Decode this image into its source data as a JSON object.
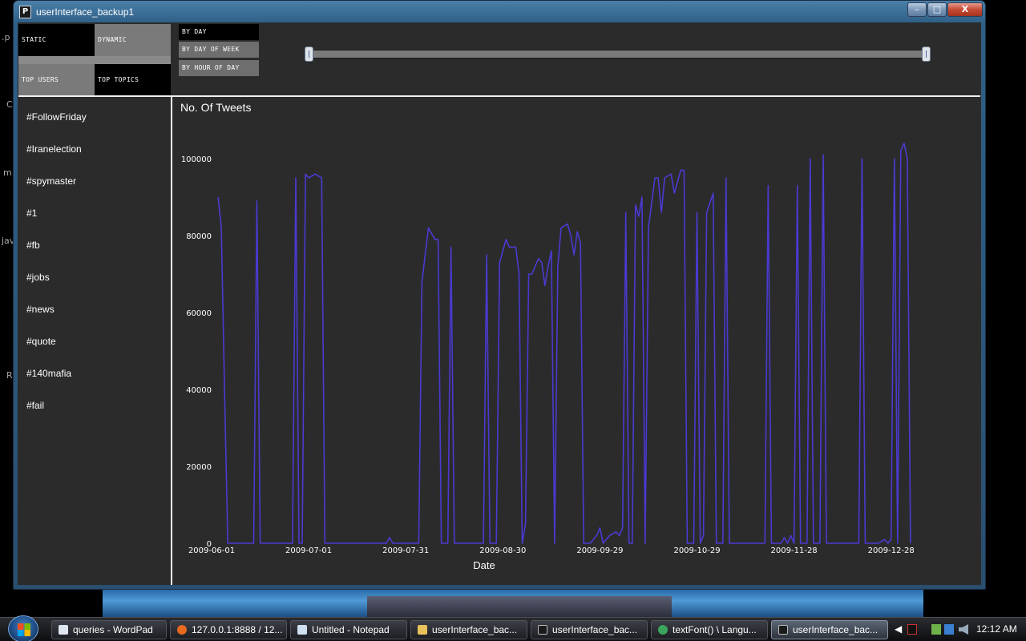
{
  "window": {
    "title": "userInterface_backup1",
    "icon_letter": "P",
    "controls": {
      "minimize": "–",
      "maximize": "□",
      "close": "X"
    }
  },
  "desktop_fragments": [
    ".p",
    "C",
    "m",
    "jav",
    "R"
  ],
  "mode_toggles": {
    "static": "STATIC",
    "dynamic": "DYNAMIC",
    "top_users": "TOP USERS",
    "top_topics": "TOP TOPICS",
    "selected_mode": "static",
    "selected_list": "top_topics"
  },
  "time_buttons": {
    "by_day": "BY DAY",
    "by_day_of_week": "BY DAY OF WEEK",
    "by_hour_of_day": "BY HOUR OF DAY",
    "selected": "by_day"
  },
  "topics": [
    "#FollowFriday",
    "#Iranelection",
    "#spymaster",
    "#1",
    "#fb",
    "#jobs",
    "#news",
    "#quote",
    "#140mafia",
    "#fail"
  ],
  "chart_data": {
    "type": "line",
    "title": "No. Of Tweets",
    "xlabel": "Date",
    "ylabel": "",
    "x_start": "2009-06-01",
    "x_end": "2009-12-31",
    "x_ticks": [
      "2009-06-01",
      "2009-07-01",
      "2009-07-31",
      "2009-08-30",
      "2009-09-29",
      "2009-10-29",
      "2009-11-28",
      "2009-12-28"
    ],
    "ylim": [
      0,
      100000
    ],
    "y_ticks": [
      0,
      20000,
      40000,
      60000,
      80000,
      100000
    ],
    "line_color": "#4a3ad0",
    "series": [
      {
        "points": [
          [
            "2009-06-03",
            90000
          ],
          [
            "2009-06-04",
            82000
          ],
          [
            "2009-06-05",
            40000
          ],
          [
            "2009-06-06",
            0
          ],
          [
            "2009-06-14",
            0
          ],
          [
            "2009-06-15",
            89000
          ],
          [
            "2009-06-16",
            0
          ],
          [
            "2009-06-26",
            0
          ],
          [
            "2009-06-27",
            95000
          ],
          [
            "2009-06-28",
            0
          ],
          [
            "2009-06-29",
            0
          ],
          [
            "2009-06-30",
            96000
          ],
          [
            "2009-07-01",
            95000
          ],
          [
            "2009-07-03",
            96000
          ],
          [
            "2009-07-05",
            95000
          ],
          [
            "2009-07-06",
            0
          ],
          [
            "2009-07-25",
            0
          ],
          [
            "2009-07-26",
            1500
          ],
          [
            "2009-07-27",
            0
          ],
          [
            "2009-08-04",
            0
          ],
          [
            "2009-08-05",
            68000
          ],
          [
            "2009-08-07",
            82000
          ],
          [
            "2009-08-09",
            79000
          ],
          [
            "2009-08-10",
            79000
          ],
          [
            "2009-08-11",
            0
          ],
          [
            "2009-08-13",
            0
          ],
          [
            "2009-08-14",
            77000
          ],
          [
            "2009-08-15",
            0
          ],
          [
            "2009-08-24",
            0
          ],
          [
            "2009-08-25",
            75000
          ],
          [
            "2009-08-26",
            0
          ],
          [
            "2009-08-28",
            0
          ],
          [
            "2009-08-29",
            73000
          ],
          [
            "2009-08-31",
            79000
          ],
          [
            "2009-09-01",
            77000
          ],
          [
            "2009-09-03",
            77000
          ],
          [
            "2009-09-04",
            70000
          ],
          [
            "2009-09-05",
            0
          ],
          [
            "2009-09-06",
            5000
          ],
          [
            "2009-09-07",
            70000
          ],
          [
            "2009-09-08",
            70000
          ],
          [
            "2009-09-10",
            74000
          ],
          [
            "2009-09-11",
            73000
          ],
          [
            "2009-09-12",
            67000
          ],
          [
            "2009-09-13",
            72000
          ],
          [
            "2009-09-14",
            76000
          ],
          [
            "2009-09-15",
            0
          ],
          [
            "2009-09-16",
            72000
          ],
          [
            "2009-09-17",
            82000
          ],
          [
            "2009-09-19",
            83000
          ],
          [
            "2009-09-20",
            80000
          ],
          [
            "2009-09-21",
            75000
          ],
          [
            "2009-09-22",
            81000
          ],
          [
            "2009-09-23",
            78000
          ],
          [
            "2009-09-24",
            0
          ],
          [
            "2009-09-26",
            0
          ],
          [
            "2009-09-28",
            2000
          ],
          [
            "2009-09-29",
            4000
          ],
          [
            "2009-09-30",
            0
          ],
          [
            "2009-10-02",
            2000
          ],
          [
            "2009-10-04",
            3000
          ],
          [
            "2009-10-05",
            2000
          ],
          [
            "2009-10-06",
            4000
          ],
          [
            "2009-10-07",
            86000
          ],
          [
            "2009-10-08",
            0
          ],
          [
            "2009-10-09",
            0
          ],
          [
            "2009-10-10",
            88000
          ],
          [
            "2009-10-11",
            85000
          ],
          [
            "2009-10-12",
            90000
          ],
          [
            "2009-10-13",
            0
          ],
          [
            "2009-10-14",
            82000
          ],
          [
            "2009-10-16",
            95000
          ],
          [
            "2009-10-17",
            95000
          ],
          [
            "2009-10-18",
            86000
          ],
          [
            "2009-10-19",
            95000
          ],
          [
            "2009-10-21",
            96000
          ],
          [
            "2009-10-22",
            91000
          ],
          [
            "2009-10-24",
            97000
          ],
          [
            "2009-10-25",
            97000
          ],
          [
            "2009-10-26",
            0
          ],
          [
            "2009-10-28",
            0
          ],
          [
            "2009-10-29",
            86000
          ],
          [
            "2009-10-30",
            0
          ],
          [
            "2009-10-31",
            2000
          ],
          [
            "2009-11-01",
            86000
          ],
          [
            "2009-11-03",
            91000
          ],
          [
            "2009-11-04",
            0
          ],
          [
            "2009-11-06",
            0
          ],
          [
            "2009-11-07",
            95000
          ],
          [
            "2009-11-08",
            0
          ],
          [
            "2009-11-19",
            0
          ],
          [
            "2009-11-20",
            93000
          ],
          [
            "2009-11-21",
            0
          ],
          [
            "2009-11-22",
            0
          ],
          [
            "2009-11-24",
            0
          ],
          [
            "2009-11-25",
            1500
          ],
          [
            "2009-11-26",
            0
          ],
          [
            "2009-11-27",
            2000
          ],
          [
            "2009-11-28",
            0
          ],
          [
            "2009-11-29",
            93000
          ],
          [
            "2009-11-30",
            0
          ],
          [
            "2009-12-02",
            0
          ],
          [
            "2009-12-03",
            100000
          ],
          [
            "2009-12-04",
            0
          ],
          [
            "2009-12-06",
            0
          ],
          [
            "2009-12-07",
            101000
          ],
          [
            "2009-12-08",
            0
          ],
          [
            "2009-12-18",
            0
          ],
          [
            "2009-12-19",
            100000
          ],
          [
            "2009-12-20",
            0
          ],
          [
            "2009-12-24",
            0
          ],
          [
            "2009-12-26",
            1000
          ],
          [
            "2009-12-27",
            0
          ],
          [
            "2009-12-28",
            1000
          ],
          [
            "2009-12-29",
            100000
          ],
          [
            "2009-12-30",
            0
          ],
          [
            "2009-12-31",
            102000
          ],
          [
            "2010-01-01",
            104000
          ],
          [
            "2010-01-02",
            100000
          ],
          [
            "2010-01-03",
            0
          ]
        ]
      }
    ]
  },
  "taskbar": {
    "items": [
      {
        "label": "queries - WordPad",
        "icon": "wordpad-icon",
        "color": "#dfe6f0"
      },
      {
        "label": "127.0.0.1:8888 / 12...",
        "icon": "firefox-icon",
        "color": "#e66a1f"
      },
      {
        "label": "Untitled - Notepad",
        "icon": "notepad-icon",
        "color": "#cfe0f0"
      },
      {
        "label": "userInterface_bac...",
        "icon": "folder-icon",
        "color": "#e8c15a"
      },
      {
        "label": "userInterface_bac...",
        "icon": "processing-icon",
        "color": "#1b1b1b"
      },
      {
        "label": "textFont() \\ Langu...",
        "icon": "chrome-icon",
        "color": "#3aa55c"
      },
      {
        "label": "userInterface_bac...",
        "icon": "processing-icon",
        "color": "#1b1b1b"
      }
    ],
    "clock": "12:12 AM"
  }
}
